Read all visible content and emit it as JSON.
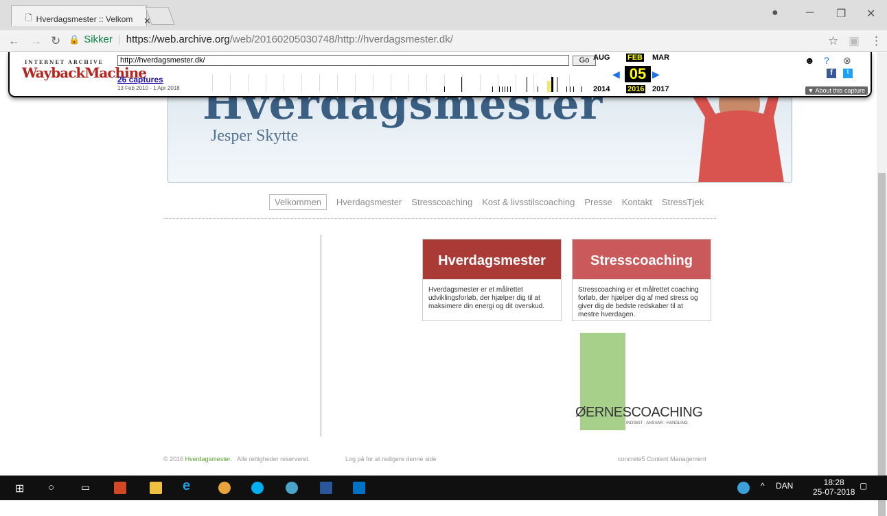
{
  "browser": {
    "tab_title": "Hverdagsmester :: Velkom",
    "secure_label": "Sikker",
    "url_host": "https://web.archive.org",
    "url_path": "/web/20160205030748/http://hverdagsmester.dk/"
  },
  "wayback": {
    "ia_text": "INTERNET ARCHIVE",
    "logo_text": "WaybackMachine",
    "url_value": "http://hverdagsmester.dk/",
    "go_label": "Go",
    "captures": "26 captures",
    "range": "13 Feb 2010 - 1 Apr 2018",
    "months": [
      "AUG",
      "FEB",
      "MAR"
    ],
    "day": "05",
    "years": [
      "2014",
      "2016",
      "2017"
    ],
    "about": "▼ About this capture"
  },
  "page": {
    "banner_title": "Hverdagsmester",
    "banner_subtitle": "Jesper Skytte",
    "nav": [
      "Velkommen",
      "Hverdagsmester",
      "Stresscoaching",
      "Kost & livsstilscoaching",
      "Presse",
      "Kontakt",
      "StressTjek"
    ],
    "box1_title": "Hverdagsmester",
    "box1_text": "Hverdagsmester er et målrettet udviklingsforløb, der hjælper dig til at maksimere din energi og dit overskud.",
    "box2_title": "Stresscoaching",
    "box2_text": "Stresscoaching er et målrettet coaching forløb, der hjælper dig af med stress og giver dig de bedste redskaber til at mestre hverdagen.",
    "logo_text": "ØERNESCOACHING",
    "logo_sub": "INDSIGT · ANSVAR · HANDLING",
    "footer_copy": "© 2016",
    "footer_site": "Hverdagsmester.",
    "footer_rights": "Alle rettigheder reserveret.",
    "footer_login": "Log på for at redigere denne side",
    "footer_cms": "concrete5 Content Management"
  },
  "taskbar": {
    "lang": "DAN",
    "time": "18:28",
    "date": "25-07-2018"
  }
}
